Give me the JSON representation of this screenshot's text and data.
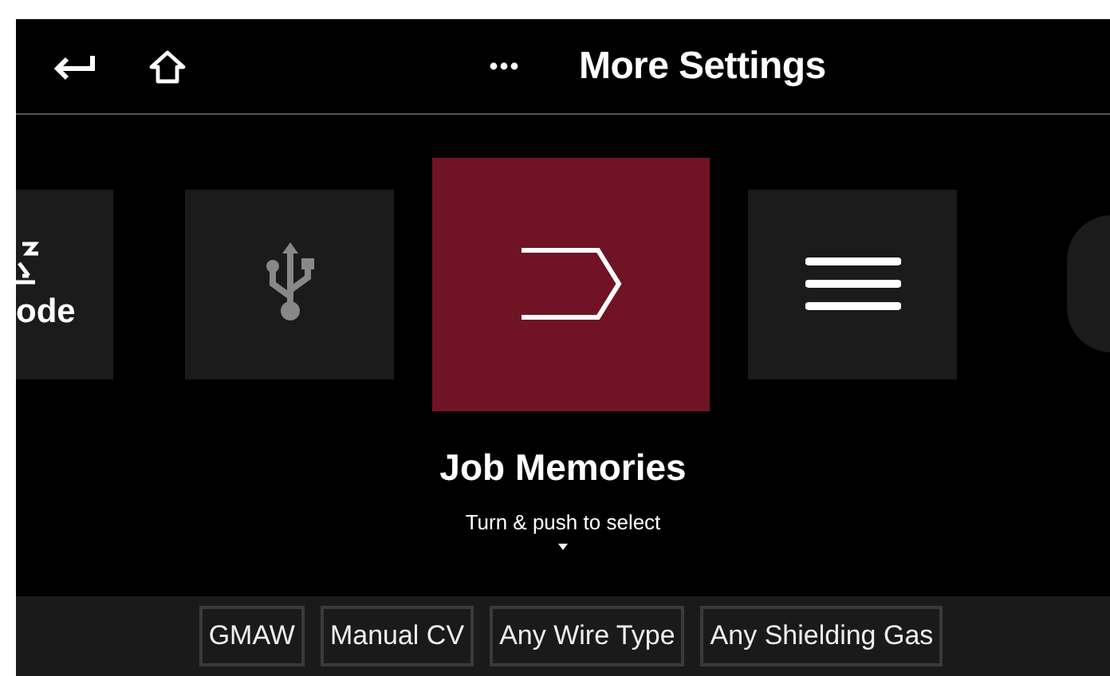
{
  "header": {
    "title": "More Settings"
  },
  "tiles": [
    {
      "kind": "mode",
      "label": "ode",
      "selected": false
    },
    {
      "kind": "usb",
      "selected": false
    },
    {
      "kind": "job",
      "selected": true
    },
    {
      "kind": "list",
      "selected": false
    }
  ],
  "selection": {
    "title": "Job Memories",
    "hint": "Turn & push to select"
  },
  "status_chips": [
    "GMAW",
    "Manual CV",
    "Any Wire Type",
    "Any Shielding Gas"
  ]
}
